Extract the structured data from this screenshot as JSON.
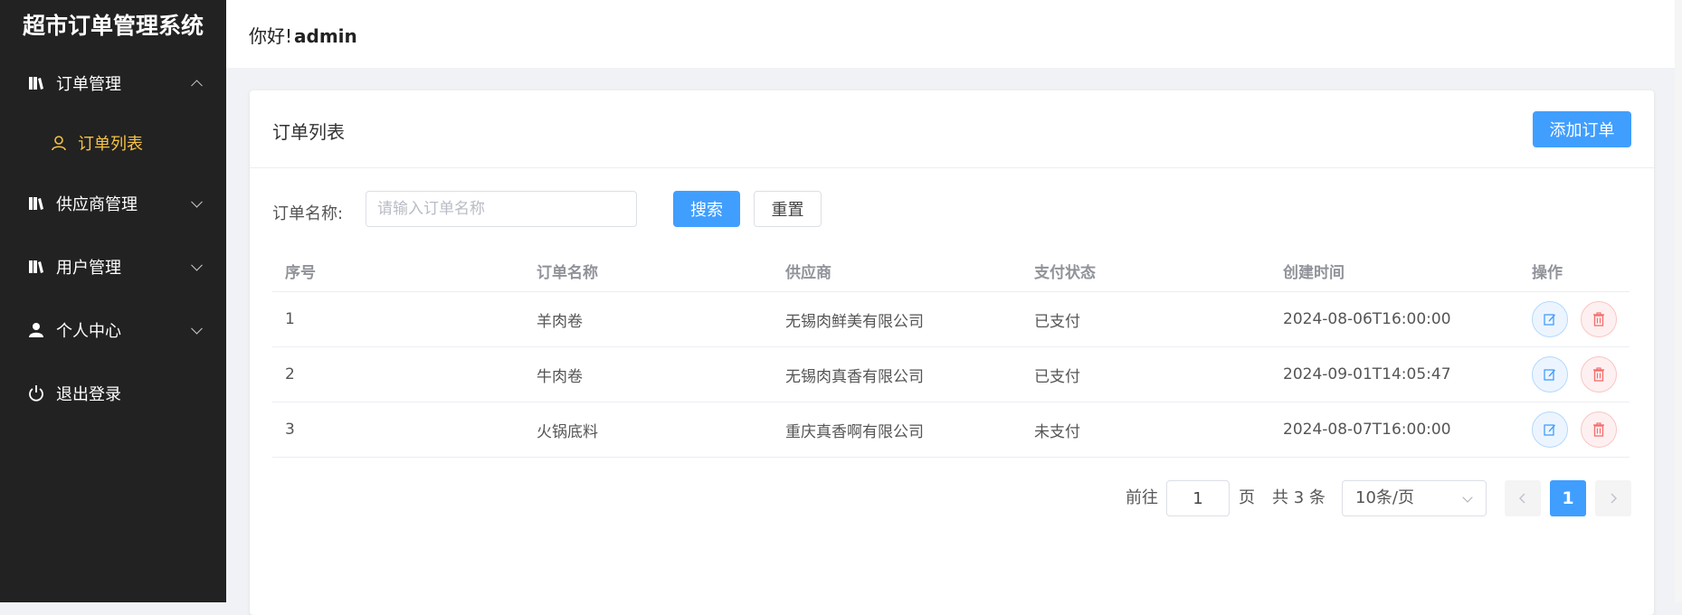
{
  "sidebar": {
    "app_title": "超市订单管理系统",
    "menu": [
      {
        "label": "订单管理",
        "icon": "book-icon",
        "expanded": true
      },
      {
        "label": "订单列表",
        "icon": "user-outline-icon",
        "active": true
      },
      {
        "label": "供应商管理",
        "icon": "book-icon",
        "expanded": false
      },
      {
        "label": "用户管理",
        "icon": "book-icon",
        "expanded": false
      },
      {
        "label": "个人中心",
        "icon": "user-icon",
        "expanded": false
      },
      {
        "label": "退出登录",
        "icon": "power-icon"
      }
    ]
  },
  "header": {
    "greeting": "你好!",
    "username": "admin"
  },
  "card": {
    "title": "订单列表",
    "add_button": "添加订单"
  },
  "search": {
    "label": "订单名称:",
    "placeholder": "请输入订单名称",
    "value": "",
    "search_button": "搜索",
    "reset_button": "重置"
  },
  "table": {
    "columns": [
      "序号",
      "订单名称",
      "供应商",
      "支付状态",
      "创建时间",
      "操作"
    ],
    "rows": [
      {
        "id": "1",
        "name": "羊肉卷",
        "supplier": "无锡肉鲜美有限公司",
        "status": "已支付",
        "created": "2024-08-06T16:00:00"
      },
      {
        "id": "2",
        "name": "牛肉卷",
        "supplier": "无锡肉真香有限公司",
        "status": "已支付",
        "created": "2024-09-01T14:05:47"
      },
      {
        "id": "3",
        "name": "火锅底料",
        "supplier": "重庆真香啊有限公司",
        "status": "未支付",
        "created": "2024-08-07T16:00:00"
      }
    ]
  },
  "pagination": {
    "goto_label": "前往",
    "goto_value": "1",
    "page_unit": "页",
    "total": "共 3 条",
    "page_size": "10条/页",
    "current_page": "1",
    "prev_icon": "chevron-left-icon",
    "next_icon": "chevron-right-icon"
  },
  "colors": {
    "primary": "#409eff",
    "sidebar_bg": "#222222",
    "active_menu": "#f5c244",
    "danger": "#f56c6c"
  }
}
